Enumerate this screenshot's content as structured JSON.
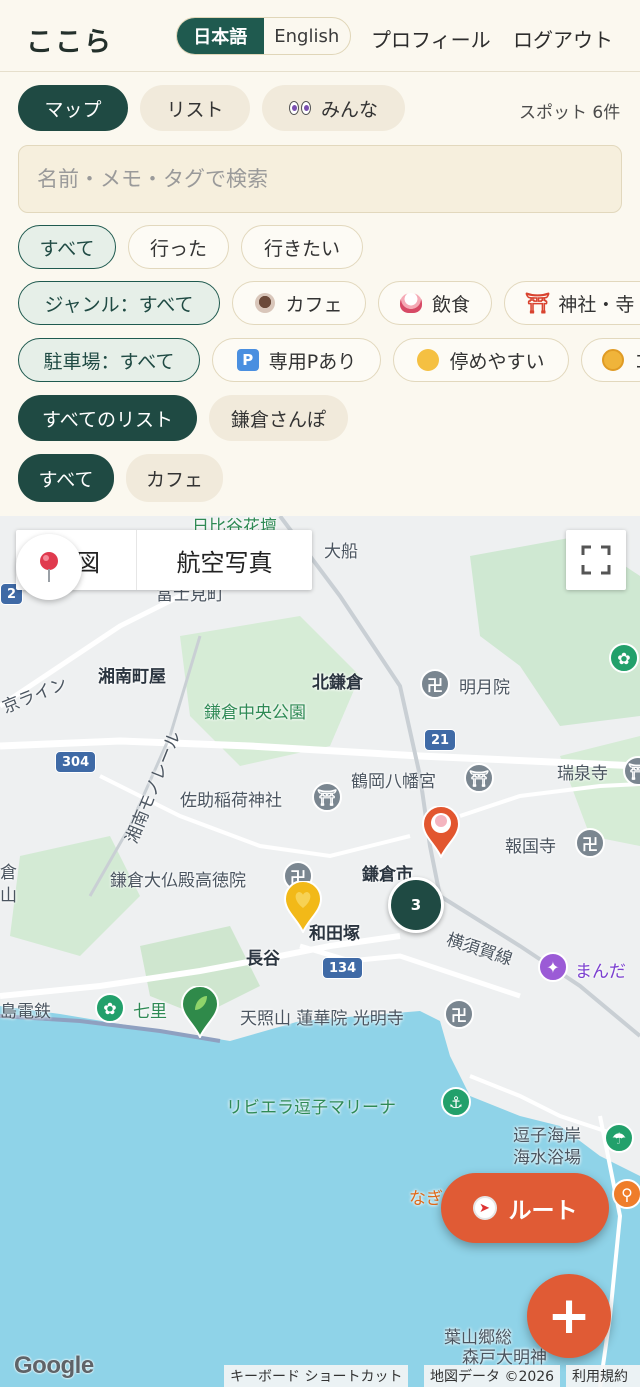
{
  "app": {
    "logo": "ここら"
  },
  "header": {
    "lang_active": "日本語",
    "lang_inactive": "English",
    "profile": "プロフィール",
    "logout": "ログアウト"
  },
  "view_tabs": {
    "map": "マップ",
    "list": "リスト",
    "everyone": "みんな"
  },
  "spot_count": "スポット 6件",
  "search": {
    "placeholder": "名前・メモ・タグで検索",
    "value": ""
  },
  "status_filters": {
    "all": "すべて",
    "visited": "行った",
    "want": "行きたい"
  },
  "genre_filters": {
    "label": "ジャンル：すべて",
    "cafe": "カフェ",
    "food": "飲食",
    "shrine": "神社・寺"
  },
  "parking_filters": {
    "label": "駐車場：すべて",
    "dedicated": "専用Pあり",
    "easy": "停めやすい",
    "coin": "コ"
  },
  "list_filters": {
    "all": "すべてのリスト",
    "kamakura": "鎌倉さんぽ"
  },
  "tag_filters": {
    "all": "すべて",
    "cafe": "カフェ"
  },
  "map": {
    "type_map": "地図",
    "type_satellite": "航空写真",
    "cluster_count": "3",
    "labels": {
      "hibiya": "日比谷花壇",
      "ofuna": "大船",
      "fujimi": "富士見町",
      "shonan_machiya": "湘南町屋",
      "keikyu": "京ライン",
      "kita_kamakura": "北鎌倉",
      "meigetsuin": "明月院",
      "park": "鎌倉中央公園",
      "monorail": "湘南モノレール",
      "tsurugaoka": "鶴岡八幡宮",
      "zuisenji": "瑞泉寺",
      "sasuke": "佐助稲荷神社",
      "hokokuji": "報国寺",
      "daibutsu": "鎌倉大仏殿高徳院",
      "kamakura_st": "鎌倉市",
      "wadazuka": "和田塚",
      "yokosuka": "横須賀線",
      "mandara": "まんだ",
      "hase": "長谷",
      "enoden": "島電鉄",
      "shichiri": "七里",
      "renge": "天照山 蓮華院 光明寺",
      "riviera": "リビエラ逗子マリーナ",
      "zushi1": "逗子海岸",
      "zushi2": "海水浴場",
      "nagisa": "なぎ",
      "hayama1": "葉山郷総",
      "hayama2": "森戸大明神",
      "left1": "倉",
      "left2": "山",
      "route304": "304",
      "route21": "21",
      "route134": "134",
      "route2": "2"
    },
    "google": "Google",
    "attrib_shortcuts": "キーボード ショートカット",
    "attrib_data": "地図データ ©2026",
    "attrib_terms": "利用規約"
  },
  "actions": {
    "route": "ルート",
    "add": "+"
  },
  "colors": {
    "accent": "#1f4a43",
    "action": "#e05b35",
    "background": "#fbf8ef"
  }
}
